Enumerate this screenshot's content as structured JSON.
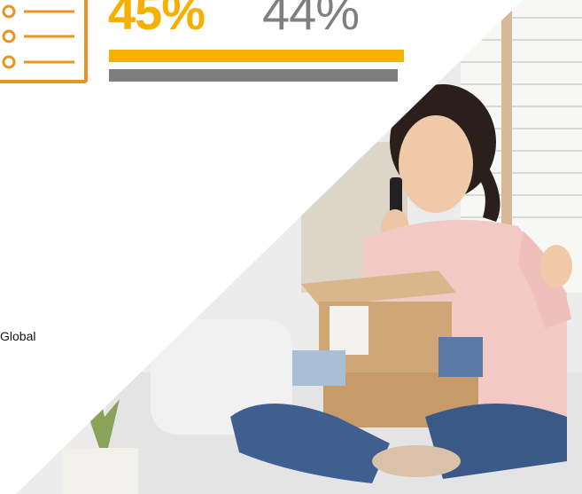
{
  "stats": {
    "primary": {
      "value_text": "45%",
      "fraction": 0.45,
      "color": "#f6b000"
    },
    "secondary": {
      "value_text": "44%",
      "fraction": 0.44,
      "color": "#7f7f7f"
    }
  },
  "region_label": "Global",
  "icon": {
    "name": "list-icon",
    "color": "#e8951f"
  },
  "photo": {
    "subject": "woman-on-phone-with-package",
    "shape": "diagonal"
  }
}
